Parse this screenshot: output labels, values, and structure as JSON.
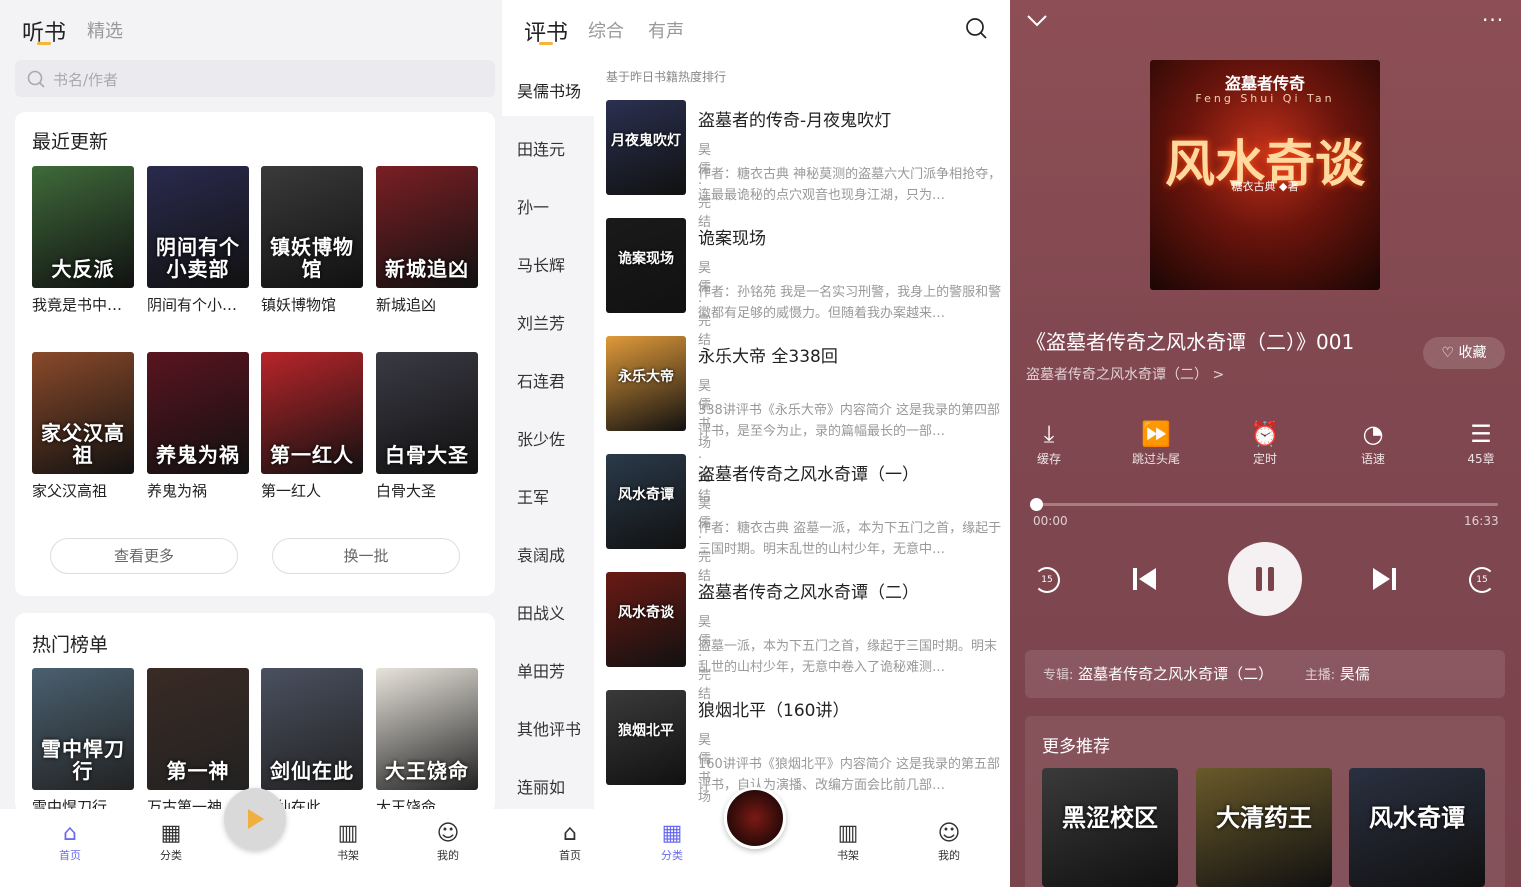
{
  "left": {
    "tabs": [
      "听书",
      "精选"
    ],
    "search_placeholder": "书名/作者",
    "recent_title": "最近更新",
    "recent_books": [
      {
        "title": "我竟是书中…",
        "cover_text": "大反派",
        "color": "#3f6a3a"
      },
      {
        "title": "阴间有个小…",
        "cover_text": "阴间有个小卖部",
        "color": "#2a2a4e"
      },
      {
        "title": "镇妖博物馆",
        "cover_text": "镇妖博物馆",
        "color": "#3a3a3a"
      },
      {
        "title": "新城追凶",
        "cover_text": "新城追凶",
        "color": "#7a1f24"
      },
      {
        "title": "家父汉高祖",
        "cover_text": "家父汉高祖",
        "color": "#8a4a2a"
      },
      {
        "title": "养鬼为祸",
        "cover_text": "养鬼为祸",
        "color": "#5a1420"
      },
      {
        "title": "第一红人",
        "cover_text": "第一红人",
        "color": "#b8252a"
      },
      {
        "title": "白骨大圣",
        "cover_text": "白骨大圣",
        "color": "#3a3a44"
      }
    ],
    "more_label": "查看更多",
    "switch_label": "换一批",
    "hot_title": "热门榜单",
    "hot_books": [
      {
        "title": "雪中悍刀行",
        "cover_text": "雪中悍刀行",
        "color": "#4a6070"
      },
      {
        "title": "万古第一神",
        "cover_text": "第一神",
        "color": "#3a2a24"
      },
      {
        "title": "剑仙在此",
        "cover_text": "剑仙在此",
        "color": "#4a5060"
      },
      {
        "title": "大王饶命",
        "cover_text": "大王饶命",
        "color": "#e8e4dc"
      }
    ],
    "nav": [
      "首页",
      "分类",
      "书架",
      "我的"
    ]
  },
  "middle": {
    "tabs": [
      "评书",
      "综合",
      "有声"
    ],
    "categories": [
      "昊儒书场",
      "田连元",
      "孙一",
      "马长辉",
      "刘兰芳",
      "石连君",
      "张少佐",
      "王军",
      "袁阔成",
      "田战义",
      "单田芳",
      "其他评书",
      "连丽如"
    ],
    "rank_note": "基于昨日书籍热度排行",
    "books": [
      {
        "title": "盗墓者的传奇-月夜鬼吹灯",
        "meta": "昊儒 · 完结",
        "desc": "作者：糖衣古典 神秘莫测的盗墓六大门派争相抢夺，连最最诡秘的点穴观音也现身江湖，只为…",
        "cover_text": "月夜鬼吹灯",
        "color": "#2a3050"
      },
      {
        "title": "诡案现场",
        "meta": "昊儒 · 完结",
        "desc": "作者：孙铭苑 我是一名实习刑警，我身上的警服和警徽都有足够的威慑力。但随着我办案越来…",
        "cover_text": "诡案现场",
        "color": "#1a1a1a"
      },
      {
        "title": "永乐大帝 全338回",
        "meta": "昊儒书场 · 完结",
        "desc": "338讲评书《永乐大帝》内容简介 这是我录的第四部评书，是至今为止，录的篇幅最长的一部…",
        "cover_text": "永乐大帝",
        "color": "#e09a3a"
      },
      {
        "title": "盗墓者传奇之风水奇谭（一）",
        "meta": "昊儒 · 完结",
        "desc": "作者：糖衣古典 盗墓一派，本为下五门之首，缘起于三国时期。明末乱世的山村少年，无意中…",
        "cover_text": "风水奇谭",
        "color": "#2a3a4a"
      },
      {
        "title": "盗墓者传奇之风水奇谭（二）",
        "meta": "昊儒 · 完结",
        "desc": "盗墓一派，本为下五门之首，缘起于三国时期。明末乱世的山村少年，无意中卷入了诡秘难测…",
        "cover_text": "风水奇谈",
        "color": "#6a1a14"
      },
      {
        "title": "狼烟北平（160讲）",
        "meta": "昊儒书场 · 完结",
        "desc": "160讲评书《狼烟北平》内容简介 这是我录的第五部评书，自认为演播、改编方面会比前几部…",
        "cover_text": "狼烟北平",
        "color": "#3a3a3a"
      }
    ],
    "nav": [
      "首页",
      "分类",
      "书架",
      "我的"
    ]
  },
  "player": {
    "cover_title": "盗墓者传奇",
    "cover_pinyin": "Feng Shui Qi Tan",
    "cover_big": "风水奇谈",
    "cover_author": "糖衣古典 ◆著",
    "track_title": "《盗墓者传奇之风水奇谭（二）》001",
    "album_link": "盗墓者传奇之风水奇谭（二） >",
    "fav_label": "收藏",
    "controls": [
      {
        "label": "缓存",
        "icon": "download-icon"
      },
      {
        "label": "跳过头尾",
        "icon": "skip-intro-icon"
      },
      {
        "label": "定时",
        "icon": "alarm-icon"
      },
      {
        "label": "语速",
        "icon": "speed-icon"
      },
      {
        "label": "45章",
        "icon": "list-icon"
      }
    ],
    "time_current": "00:00",
    "time_total": "16:33",
    "progress": 0.0,
    "rewind_label": "15",
    "forward_label": "15",
    "album_label": "专辑:",
    "album_name": "盗墓者传奇之风水奇谭（二）",
    "host_label": "主播:",
    "host_name": "昊儒",
    "more_title": "更多推荐",
    "recommendations": [
      {
        "cover_text": "黑涩校区",
        "color": "#3a3a3a"
      },
      {
        "cover_text": "大清药王",
        "color": "#6a5a2a"
      },
      {
        "cover_text": "风水奇谭",
        "color": "#2a3040"
      }
    ]
  }
}
